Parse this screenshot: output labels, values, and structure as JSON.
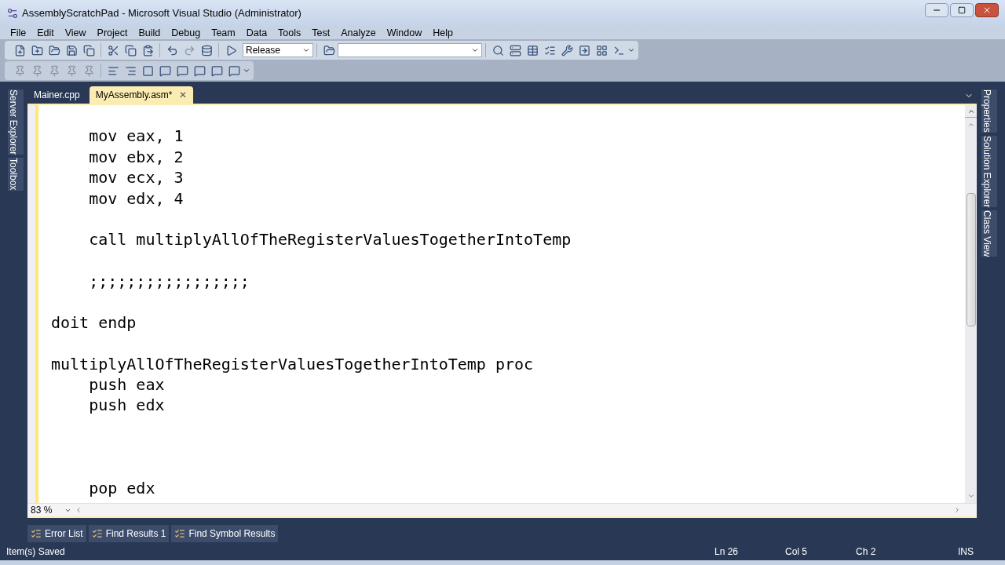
{
  "window": {
    "title": "AssemblyScratchPad - Microsoft Visual Studio (Administrator)"
  },
  "menu": [
    "File",
    "Edit",
    "View",
    "Project",
    "Build",
    "Debug",
    "Team",
    "Data",
    "Tools",
    "Test",
    "Analyze",
    "Window",
    "Help"
  ],
  "toolbar": {
    "configuration": "Release"
  },
  "left_tool_tabs": [
    "Server Explorer",
    "Toolbox"
  ],
  "right_tool_tabs": [
    "Properties",
    "Solution Explorer",
    "Class View"
  ],
  "document_tabs": [
    {
      "label": "Mainer.cpp",
      "selected": false
    },
    {
      "label": "MyAssembly.asm*",
      "selected": true,
      "close": "✕"
    }
  ],
  "editor": {
    "zoom": "83 %",
    "lines": [
      {
        "kind": "blank"
      },
      {
        "kind": "code",
        "text": "    mov eax, 1"
      },
      {
        "kind": "code",
        "text": "    mov ebx, 2"
      },
      {
        "kind": "code",
        "text": "    mov ecx, 3"
      },
      {
        "kind": "code",
        "text": "    mov edx, 4"
      },
      {
        "kind": "blank"
      },
      {
        "kind": "code",
        "text": "    call multiplyAllOfTheRegisterValuesTogetherIntoTemp"
      },
      {
        "kind": "blank"
      },
      {
        "kind": "code",
        "text": "    ;;;;;;;;;;;;;;;;;"
      },
      {
        "kind": "blank"
      },
      {
        "kind": "code",
        "text": "doit endp"
      },
      {
        "kind": "blank"
      },
      {
        "kind": "code",
        "text": "multiplyAllOfTheRegisterValuesTogetherIntoTemp proc"
      },
      {
        "kind": "code",
        "text": "    push eax"
      },
      {
        "kind": "code",
        "text": "    push edx"
      },
      {
        "kind": "blank"
      },
      {
        "kind": "blank"
      },
      {
        "kind": "blank"
      },
      {
        "kind": "code",
        "text": "    pop edx"
      }
    ]
  },
  "bottom_tool_tabs": [
    "Error List",
    "Find Results 1",
    "Find Symbol Results"
  ],
  "status_bar": {
    "message": "Item(s) Saved",
    "line": "Ln 26",
    "column": "Col 5",
    "char": "Ch 2",
    "mode": "INS"
  }
}
